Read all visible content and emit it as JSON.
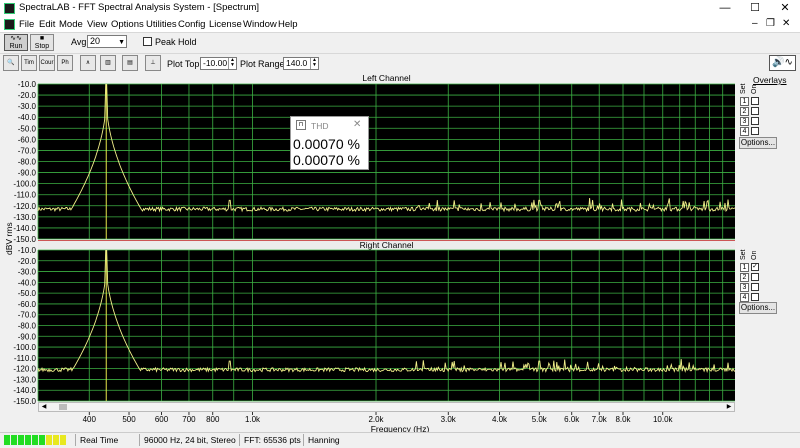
{
  "window": {
    "title": "SpectraLAB - FFT Spectral Analysis System - [Spectrum]",
    "minimize_icon": "minimize-icon",
    "maximize_icon": "maximize-icon",
    "close_icon": "close-icon",
    "min_glyph": "—",
    "max_glyph": "☐",
    "close_glyph": "✕"
  },
  "menu": {
    "items": [
      "File",
      "Edit",
      "Mode",
      "View",
      "Options",
      "Utilities",
      "Config",
      "License",
      "Window",
      "Help"
    ],
    "restore_glyph": "❐",
    "min_glyph": "–",
    "close_glyph": "✕"
  },
  "toolbar": {
    "run_label": "Run",
    "stop_label": "Stop",
    "avg_label": "Avg:",
    "avg_value": "20",
    "peak_hold_label": "Peak Hold",
    "peak_hold_checked": false,
    "small_buttons": [
      "zoom-icon",
      "time-series-icon",
      "cursor-readout-icon",
      "phase-icon",
      "spectrum-icon",
      "spectrogram-icon",
      "table-icon",
      "marker-icon"
    ],
    "small_button_texts": [
      "🔍",
      "Tim Ser",
      "Cour",
      "Ph",
      "∧",
      "▥",
      "▤",
      "⊥"
    ],
    "plot_top_label": "Plot Top:",
    "plot_top_value": "-10.00",
    "plot_range_label": "Plot Range:",
    "plot_range_value": "140.0",
    "speaker_icon": "speaker-icon",
    "speaker_glyph": "🔊∿"
  },
  "channels": {
    "left_title": "Left Channel",
    "right_title": "Right Channel"
  },
  "overlays": {
    "title": "Overlays",
    "set_label": "Set",
    "on_label": "On",
    "numbers": [
      "1",
      "2",
      "3",
      "4"
    ],
    "left_checked": [
      false,
      false,
      false,
      false
    ],
    "right_checked": [
      true,
      false,
      false,
      false
    ],
    "options_label": "Options..."
  },
  "axes": {
    "y_label": "dBV rms",
    "x_label": "Frequency (Hz)",
    "y_ticks": [
      "-10.0",
      "-20.0",
      "-30.0",
      "-40.0",
      "-50.0",
      "-60.0",
      "-70.0",
      "-80.0",
      "-90.0",
      "-100.0",
      "-110.0",
      "-120.0",
      "-130.0",
      "-140.0",
      "-150.0"
    ],
    "x_ticks": [
      "400",
      "500",
      "600",
      "700",
      "800",
      "1.0k",
      "2.0k",
      "3.0k",
      "4.0k",
      "5.0k",
      "6.0k",
      "7.0k",
      "8.0k",
      "10.0k"
    ]
  },
  "thd": {
    "title": "THD",
    "left_value": "0.00070 %",
    "right_value": "0.00070 %"
  },
  "status": {
    "mode": "Real Time",
    "format": "96000 Hz, 24 bit, Stereo",
    "fft": "FFT: 65536 pts",
    "window": "Hanning",
    "meter_segments": [
      "#22dd22",
      "#22dd22",
      "#22dd22",
      "#22dd22",
      "#22dd22",
      "#22dd22",
      "#e8e820",
      "#e8e820",
      "#e8e820"
    ]
  },
  "colors": {
    "plot_bg": "#000000",
    "grid": "#3cb043",
    "trace": "#f2f08a",
    "peak_line": "#e6e64a"
  },
  "chart_data": {
    "type": "line",
    "x_scale": "log",
    "y_range": [
      -150,
      -10
    ],
    "x_range_hz": [
      300,
      15000
    ],
    "series": [
      {
        "fundamental_hz": 440,
        "peak_db": -10.5,
        "noise_floor_db": -123
      },
      {
        "fundamental_hz": 440,
        "peak_db": -10.5,
        "noise_floor_db": -121
      }
    ]
  }
}
